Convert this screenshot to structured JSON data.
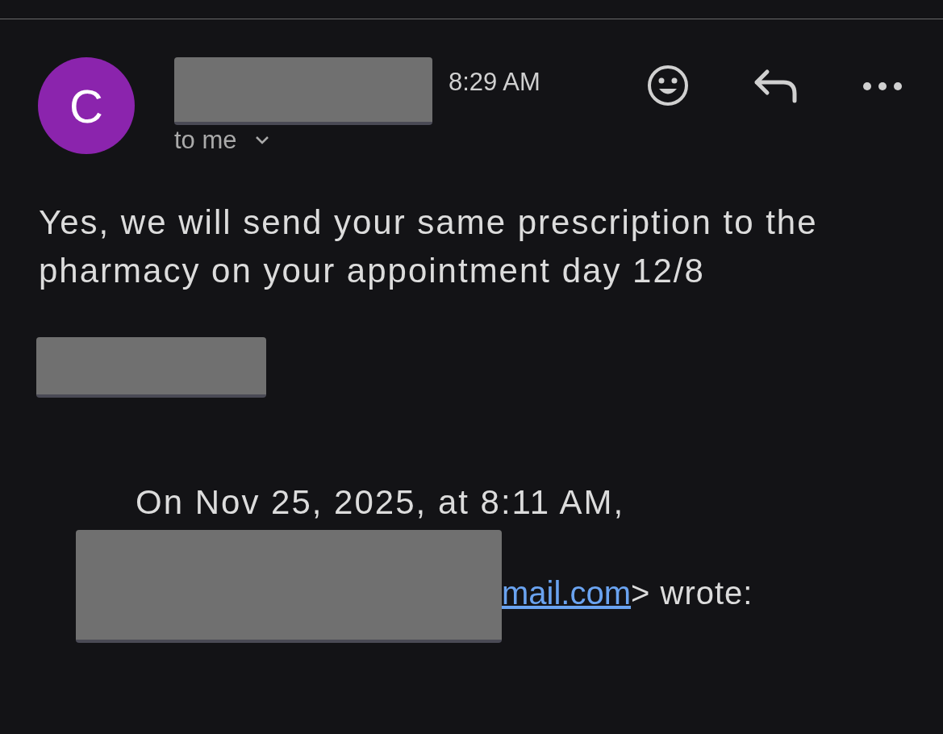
{
  "message": {
    "avatar_letter": "C",
    "time": "8:29 AM",
    "recipient": "to me",
    "body": "Yes, we will send your same prescription to the pharmacy on your appointment day 12/8"
  },
  "quote": {
    "header": "On Nov 25, 2025, at 8:11 AM,",
    "link": "mail.com",
    "suffix": "> wrote:"
  }
}
